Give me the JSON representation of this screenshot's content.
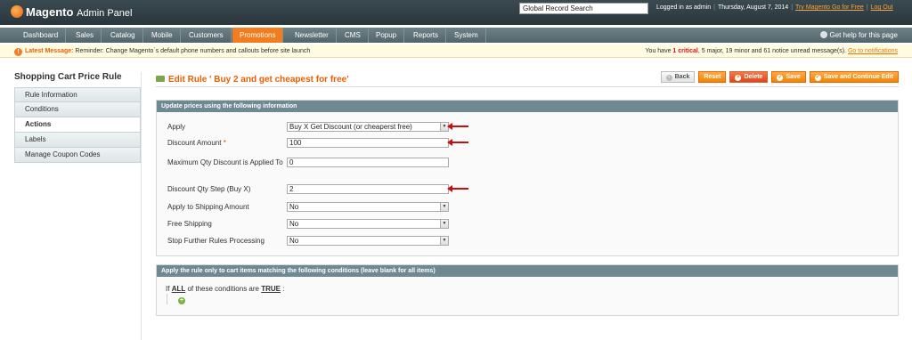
{
  "header": {
    "logo_brand": "Magento",
    "logo_sub": "Admin Panel",
    "search_value": "Global Record Search",
    "logged_in": "Logged in as admin",
    "date": "Thursday, August 7, 2014",
    "try_link": "Try Magento Go for Free",
    "logout": "Log Out"
  },
  "nav": {
    "items": [
      "Dashboard",
      "Sales",
      "Catalog",
      "Mobile",
      "Customers",
      "Promotions",
      "Newsletter",
      "CMS",
      "Popup",
      "Reports",
      "System"
    ],
    "active": "Promotions",
    "help": "Get help for this page"
  },
  "notice": {
    "label": "Latest Message:",
    "message": "Reminder: Change Magento`s default phone numbers and callouts before site launch",
    "right_prefix": "You have",
    "critical_count": "1",
    "critical_word": "critical",
    "rest": ", 5 major, 19 minor and 61 notice unread message(s).",
    "link": "Go to notifications"
  },
  "sidebar": {
    "title": "Shopping Cart Price Rule",
    "items": [
      "Rule Information",
      "Conditions",
      "Actions",
      "Labels",
      "Manage Coupon Codes"
    ],
    "active": "Actions"
  },
  "page": {
    "title": "Edit Rule ' Buy 2 and get cheapest for free'",
    "buttons": {
      "back": "Back",
      "reset": "Reset",
      "delete": "Delete",
      "save": "Save",
      "save_continue": "Save and Continue Edit"
    }
  },
  "actions_form": {
    "legend": "Update prices using the following information",
    "apply_label": "Apply",
    "apply_value": "Buy X Get Discount (or cheaperst free)",
    "discount_amount_label": "Discount Amount",
    "required_mark": "*",
    "discount_amount_value": "100",
    "max_qty_label": "Maximum Qty Discount is Applied To",
    "max_qty_value": "0",
    "qty_step_label": "Discount Qty Step (Buy X)",
    "qty_step_value": "2",
    "apply_shipping_label": "Apply to Shipping Amount",
    "apply_shipping_value": "No",
    "free_shipping_label": "Free Shipping",
    "free_shipping_value": "No",
    "stop_rules_label": "Stop Further Rules Processing",
    "stop_rules_value": "No"
  },
  "conditions_form": {
    "legend": "Apply the rule only to cart items matching the following conditions (leave blank for all items)",
    "if_word": "If",
    "all_word": "ALL",
    "middle": "of these conditions are",
    "true_word": "TRUE",
    "colon": ":"
  },
  "icons": [
    "dropdown-arrow-icon",
    "add-condition-icon",
    "annotation-arrow-icon"
  ]
}
